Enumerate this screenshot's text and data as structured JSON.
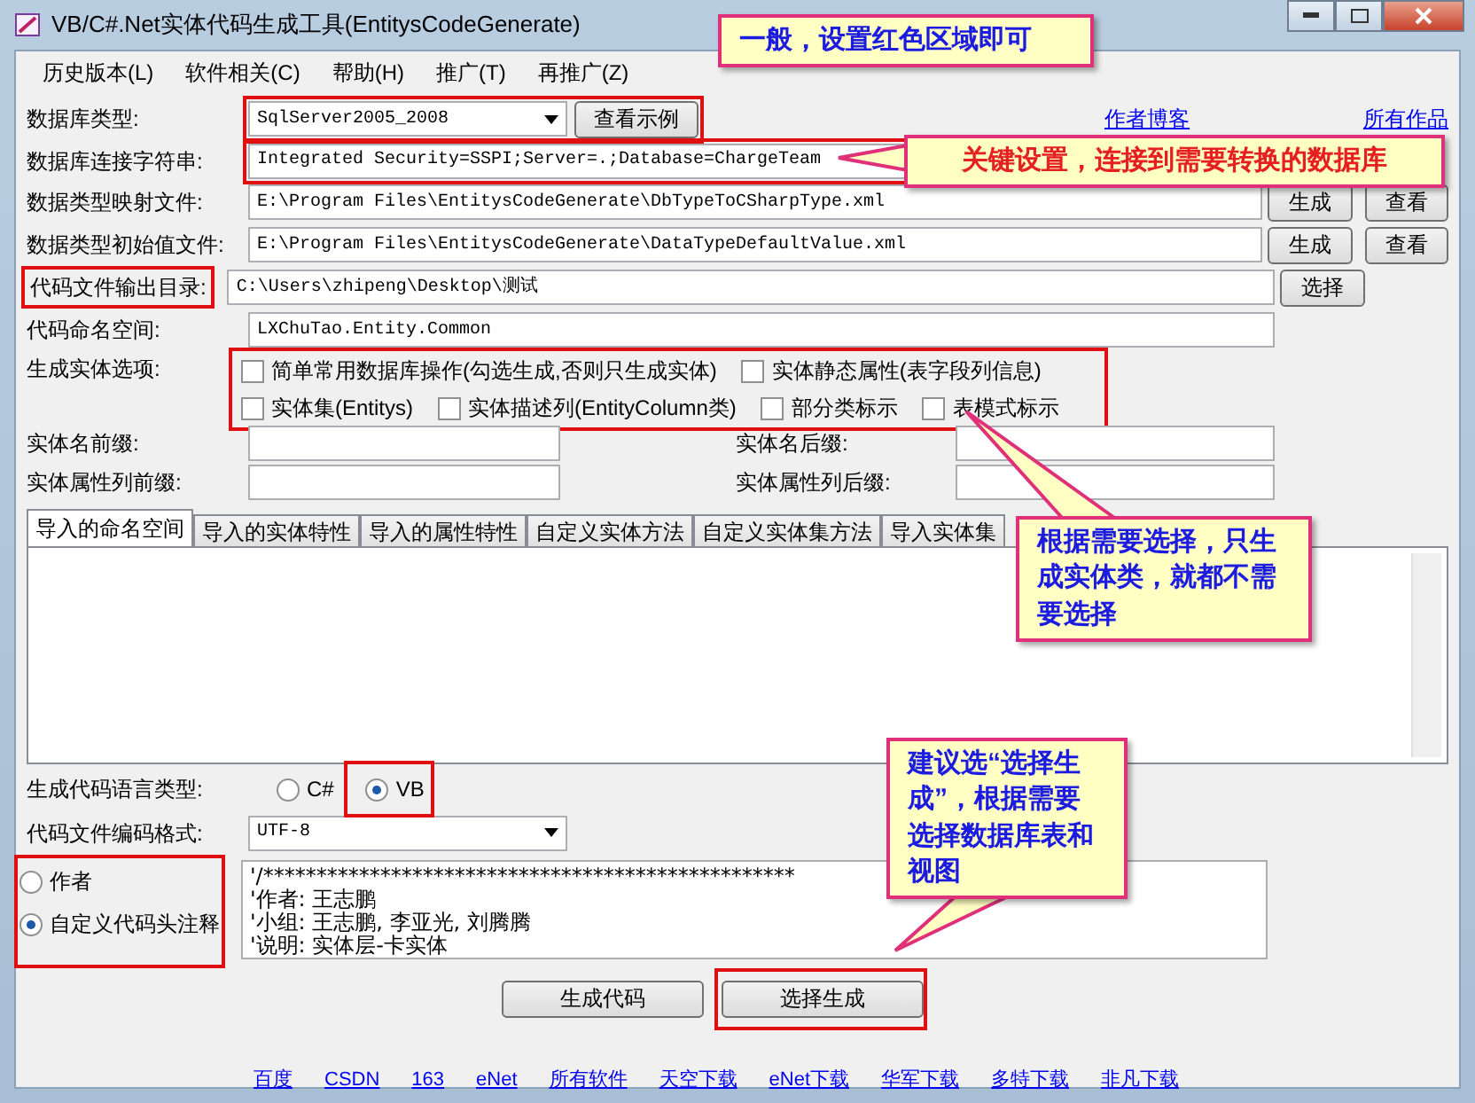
{
  "window": {
    "title": "VB/C#.Net实体代码生成工具(EntitysCodeGenerate)"
  },
  "menu": [
    "历史版本(L)",
    "软件相关(C)",
    "帮助(H)",
    "推广(T)",
    "再推广(Z)"
  ],
  "db_type": {
    "label": "数据库类型:",
    "value": "SqlServer2005_2008",
    "button": "查看示例",
    "highlighted": true
  },
  "top_links": [
    "作者博客",
    "所有作品"
  ],
  "connection": {
    "label": "数据库连接字符串:",
    "value": "Integrated Security=SSPI;Server=.;Database=ChargeTeam",
    "highlighted": true
  },
  "fields": [
    {
      "label": "数据类型映射文件:",
      "value": "E:\\Program Files\\EntitysCodeGenerate\\DbTypeToCSharpType.xml",
      "label_highlighted": false,
      "buttons": [
        "生成",
        "查看"
      ]
    },
    {
      "label": "数据类型初始值文件:",
      "value": "E:\\Program Files\\EntitysCodeGenerate\\DataTypeDefaultValue.xml",
      "label_highlighted": false,
      "buttons": [
        "生成",
        "查看"
      ]
    },
    {
      "label": "代码文件输出目录:",
      "value": "C:\\Users\\zhipeng\\Desktop\\测试",
      "label_highlighted": true,
      "buttons": [
        "选择"
      ]
    },
    {
      "label": "代码命名空间:",
      "value": "LXChuTao.Entity.Common",
      "label_highlighted": false
    }
  ],
  "entity_options": {
    "label": "生成实体选项:",
    "highlighted": true,
    "options": [
      {
        "label": "简单常用数据库操作(勾选生成,否则只生成实体)",
        "checked": false
      },
      {
        "label": "实体静态属性(表字段列信息)",
        "checked": false
      },
      {
        "label": "实体集(Entitys)",
        "checked": false
      },
      {
        "label": "实体描述列(EntityColumn类)",
        "checked": false
      },
      {
        "label": "部分类标示",
        "checked": false
      },
      {
        "label": "表模式标示",
        "checked": false
      }
    ]
  },
  "affixes": [
    [
      "实体名前缀:",
      "实体名后缀:"
    ],
    [
      "实体属性列前缀:",
      "实体属性列后缀:"
    ]
  ],
  "tabs": [
    {
      "label": "导入的命名空间",
      "selected": true
    },
    {
      "label": "导入的实体特性",
      "selected": false
    },
    {
      "label": "导入的属性特性",
      "selected": false
    },
    {
      "label": "自定义实体方法",
      "selected": false
    },
    {
      "label": "自定义实体集方法",
      "selected": false
    },
    {
      "label": "导入实体集",
      "selected": false
    }
  ],
  "language": {
    "label": "生成代码语言类型:",
    "options": [
      {
        "label": "C#",
        "selected": false,
        "highlighted": false
      },
      {
        "label": "VB",
        "selected": true,
        "highlighted": true
      }
    ]
  },
  "encoding": {
    "label": "代码文件编码格式:",
    "value": "UTF-8"
  },
  "header_mode": {
    "highlighted": true,
    "options": [
      {
        "label": "作者",
        "selected": false
      },
      {
        "label": "自定义代码头注释",
        "selected": true
      }
    ]
  },
  "header_text": [
    "'/**************************************************",
    "'作者: 王志鹏",
    "'小组: 王志鹏, 李亚光, 刘腾腾",
    "'说明: 实体层-卡实体"
  ],
  "actions": [
    {
      "label": "生成代码",
      "highlighted": false
    },
    {
      "label": "选择生成",
      "highlighted": true
    }
  ],
  "footer_links": [
    "百度",
    "CSDN",
    "163",
    "eNet",
    "所有软件",
    "天空下载",
    "eNet下载",
    "华军下载",
    "多特下载",
    "非凡下载"
  ],
  "callouts": [
    {
      "text": "一般，设置红色区域即可",
      "color": "#1c1ce0"
    },
    {
      "text": "关键设置，连接到需要转换的数据库",
      "color": "#e52020"
    },
    {
      "text": "根据需要选择，只生成实体类，就都不需要选择",
      "color": "#1c1ce0"
    },
    {
      "text": "建议选“选择生成”，根据需要选择数据库表和视图",
      "color": "#1c1ce0"
    }
  ]
}
